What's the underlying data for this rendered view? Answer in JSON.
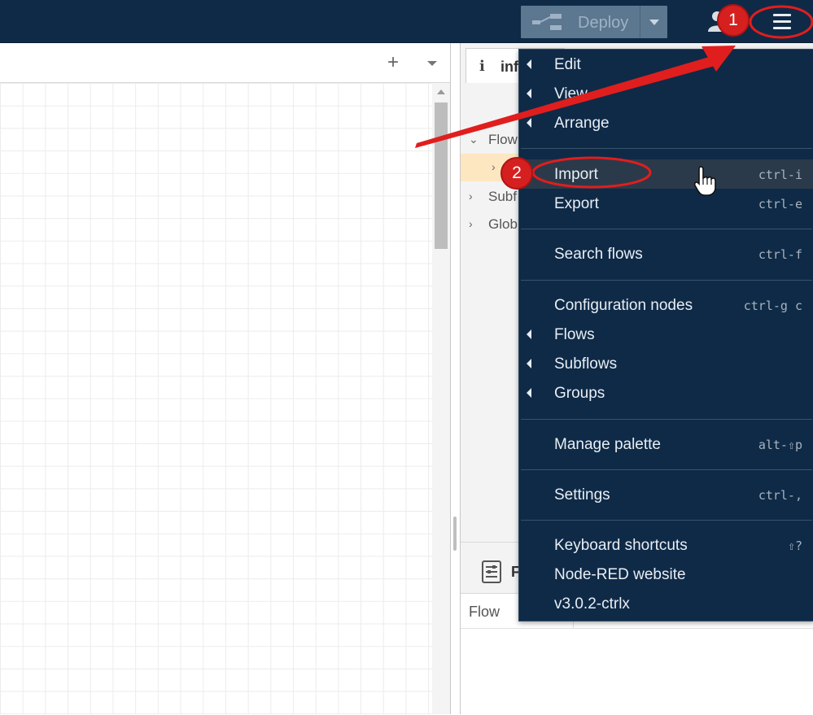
{
  "header": {
    "deploy_label": "Deploy",
    "deploy_icon": "deploy-flow-icon",
    "user_icon": "user-icon",
    "menu_icon": "hamburger-menu-icon"
  },
  "workspace": {
    "add_icon": "+",
    "tabs_caret": "chevron-down-icon"
  },
  "sidebar": {
    "tab_icon": "i",
    "tab_label": "inf",
    "tree": [
      {
        "caret": "⌄",
        "label": "Flow"
      },
      {
        "caret": "›",
        "label": ""
      },
      {
        "caret": "›",
        "label": "Subf"
      },
      {
        "caret": "›",
        "label": "Glob"
      }
    ],
    "lower_label": "F",
    "lower_key": "Flow"
  },
  "menu": {
    "items": [
      {
        "label": "Edit",
        "shortcut": "",
        "submenu": true
      },
      {
        "label": "View",
        "shortcut": "",
        "submenu": true
      },
      {
        "label": "Arrange",
        "shortcut": "",
        "submenu": true
      },
      {
        "label": "Import",
        "shortcut": "ctrl-i",
        "submenu": false
      },
      {
        "label": "Export",
        "shortcut": "ctrl-e",
        "submenu": false
      },
      {
        "label": "Search flows",
        "shortcut": "ctrl-f",
        "submenu": false
      },
      {
        "label": "Configuration nodes",
        "shortcut": "ctrl-g c",
        "submenu": false
      },
      {
        "label": "Flows",
        "shortcut": "",
        "submenu": true
      },
      {
        "label": "Subflows",
        "shortcut": "",
        "submenu": true
      },
      {
        "label": "Groups",
        "shortcut": "",
        "submenu": true
      },
      {
        "label": "Manage palette",
        "shortcut": "alt-⇧p",
        "submenu": false
      },
      {
        "label": "Settings",
        "shortcut": "ctrl-,",
        "submenu": false
      },
      {
        "label": "Keyboard shortcuts",
        "shortcut": "⇧?",
        "submenu": false
      },
      {
        "label": "Node-RED website",
        "shortcut": "",
        "submenu": false
      },
      {
        "label": "v3.0.2-ctrlx",
        "shortcut": "",
        "submenu": false
      }
    ]
  },
  "annotations": {
    "badge1": "1",
    "badge2": "2",
    "color": "#e01e1e"
  },
  "colors": {
    "header_bg": "#0f2a47",
    "menu_bg": "#0f2a47",
    "menu_hover": "#2b3a4a",
    "selected_row": "#fde7c1"
  }
}
